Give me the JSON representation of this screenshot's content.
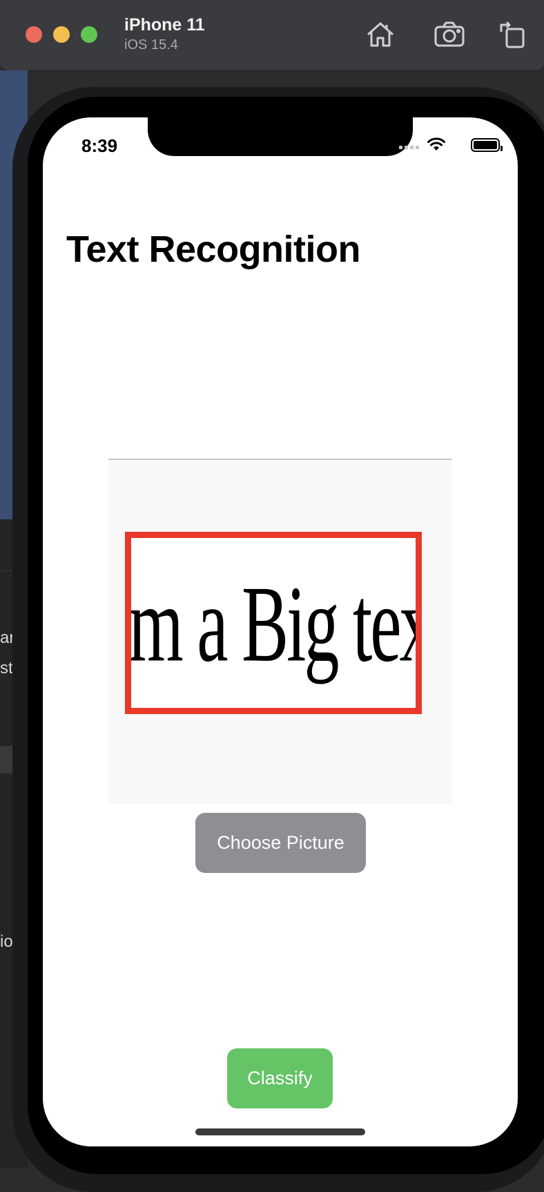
{
  "simulator": {
    "device_name": "iPhone 11",
    "os_version": "iOS 15.4",
    "toolbar_icons": [
      "home-icon",
      "screenshot-icon",
      "rotate-icon"
    ]
  },
  "desktop": {
    "fragments": [
      "ar",
      "st",
      "io"
    ]
  },
  "status_bar": {
    "time": "8:39",
    "icons": [
      "cellular-signal-icon",
      "wifi-icon",
      "battery-icon"
    ]
  },
  "app": {
    "title": "Text Recognition",
    "image_text": "I'm a Big text",
    "choose_button": "Choose Picture",
    "classify_button": "Classify"
  },
  "colors": {
    "choose_button": "#8e8e93",
    "classify_button": "#65c466",
    "image_border": "#e8392a"
  }
}
